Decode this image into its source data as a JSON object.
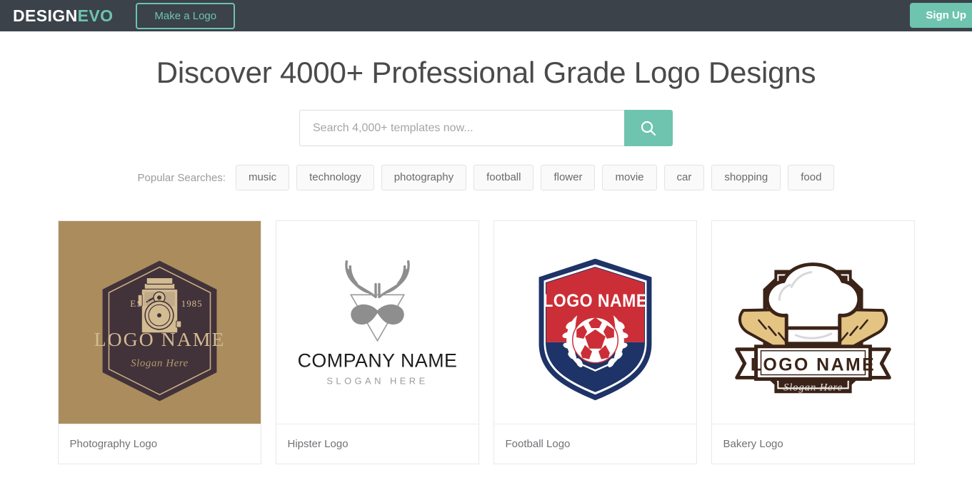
{
  "navbar": {
    "brand_first": "DESIGN",
    "brand_second": "EVO",
    "make_logo_label": "Make a Logo",
    "signup_label": "Sign Up",
    "bg_color": "#3b424a",
    "accent_color": "#6ec4ae"
  },
  "hero": {
    "title": "Discover 4000+ Professional Grade Logo Designs"
  },
  "search": {
    "value": "",
    "placeholder": "Search 4,000+ templates now...",
    "button_icon": "search-icon"
  },
  "popular": {
    "label": "Popular Searches:",
    "tags": [
      "music",
      "technology",
      "photography",
      "football",
      "flower",
      "movie",
      "car",
      "shopping",
      "food"
    ]
  },
  "templates": [
    {
      "name": "Photography Logo",
      "thumb_bg": "#ab8d5d",
      "logo_text": {
        "est_left": "EST",
        "est_right": "1985",
        "title": "LOGO NAME",
        "slogan": "Slogan Here"
      }
    },
    {
      "name": "Hipster Logo",
      "thumb_bg": "#ffffff",
      "logo_text": {
        "title": "COMPANY NAME",
        "slogan": "SLOGAN HERE"
      }
    },
    {
      "name": "Football Logo",
      "thumb_bg": "#ffffff",
      "logo_text": {
        "title": "LOGO NAME"
      }
    },
    {
      "name": "Bakery Logo",
      "thumb_bg": "#ffffff",
      "logo_text": {
        "title": "LOGO NAME",
        "slogan": "Slogan Here"
      }
    }
  ]
}
